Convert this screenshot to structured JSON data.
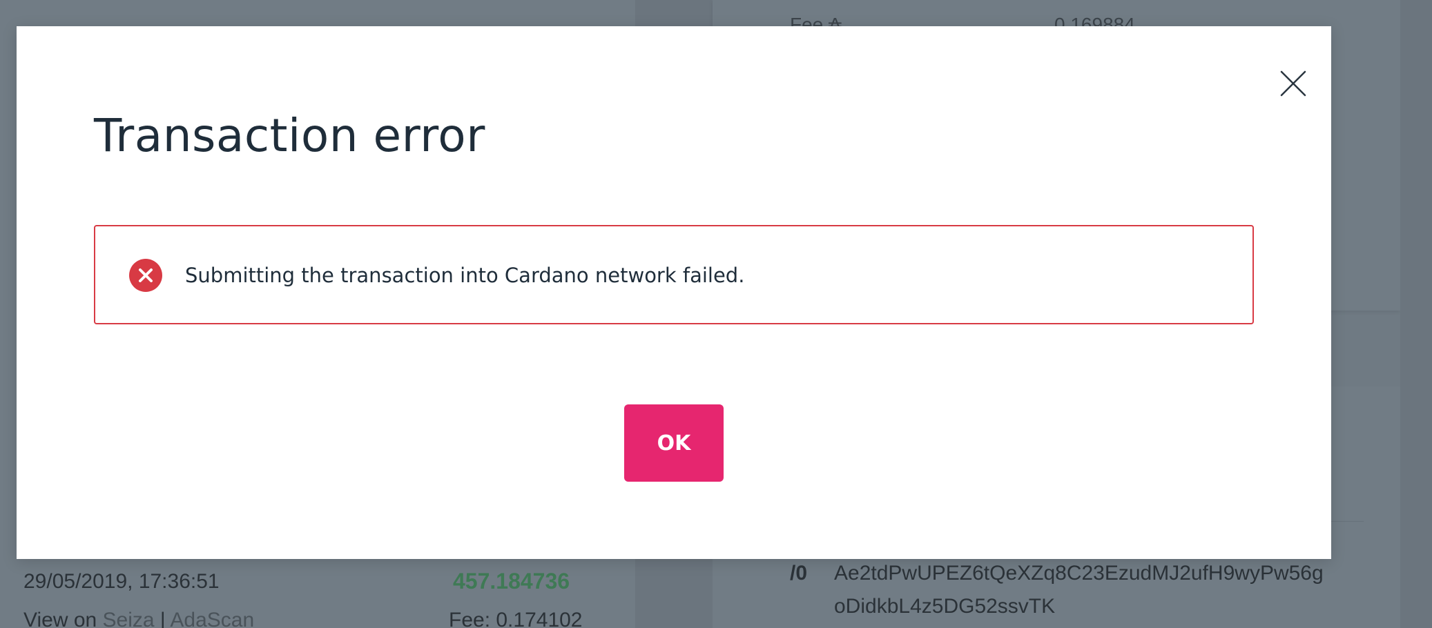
{
  "background": {
    "fee_label": "Fee ₳",
    "fee_value": "0.169884",
    "transaction": {
      "date": "29/05/2019, 17:36:51",
      "amount": "457.184736",
      "view_on_label": "View on",
      "link_seiza": "Seiza",
      "separator": "|",
      "link_adascan": "AdaScan",
      "fee": "Fee: 0.174102"
    },
    "output": {
      "index": "/0",
      "address_line_1": "Ae2tdPwUPEZ6tQeXZq8C23EzudMJ2ufH9wyPw56g",
      "address_line_2": "oDidkbL4z5DG52ssvTK"
    }
  },
  "modal": {
    "title": "Transaction error",
    "error_message": "Submitting the transaction into Cardano network failed.",
    "ok_label": "OK",
    "close_icon": "close-icon",
    "error_icon": "error-circle-x-icon"
  },
  "colors": {
    "accent": "#e6266f",
    "error": "#d83a44",
    "title": "#1f2d3a",
    "overlay": "#6f7a83"
  }
}
